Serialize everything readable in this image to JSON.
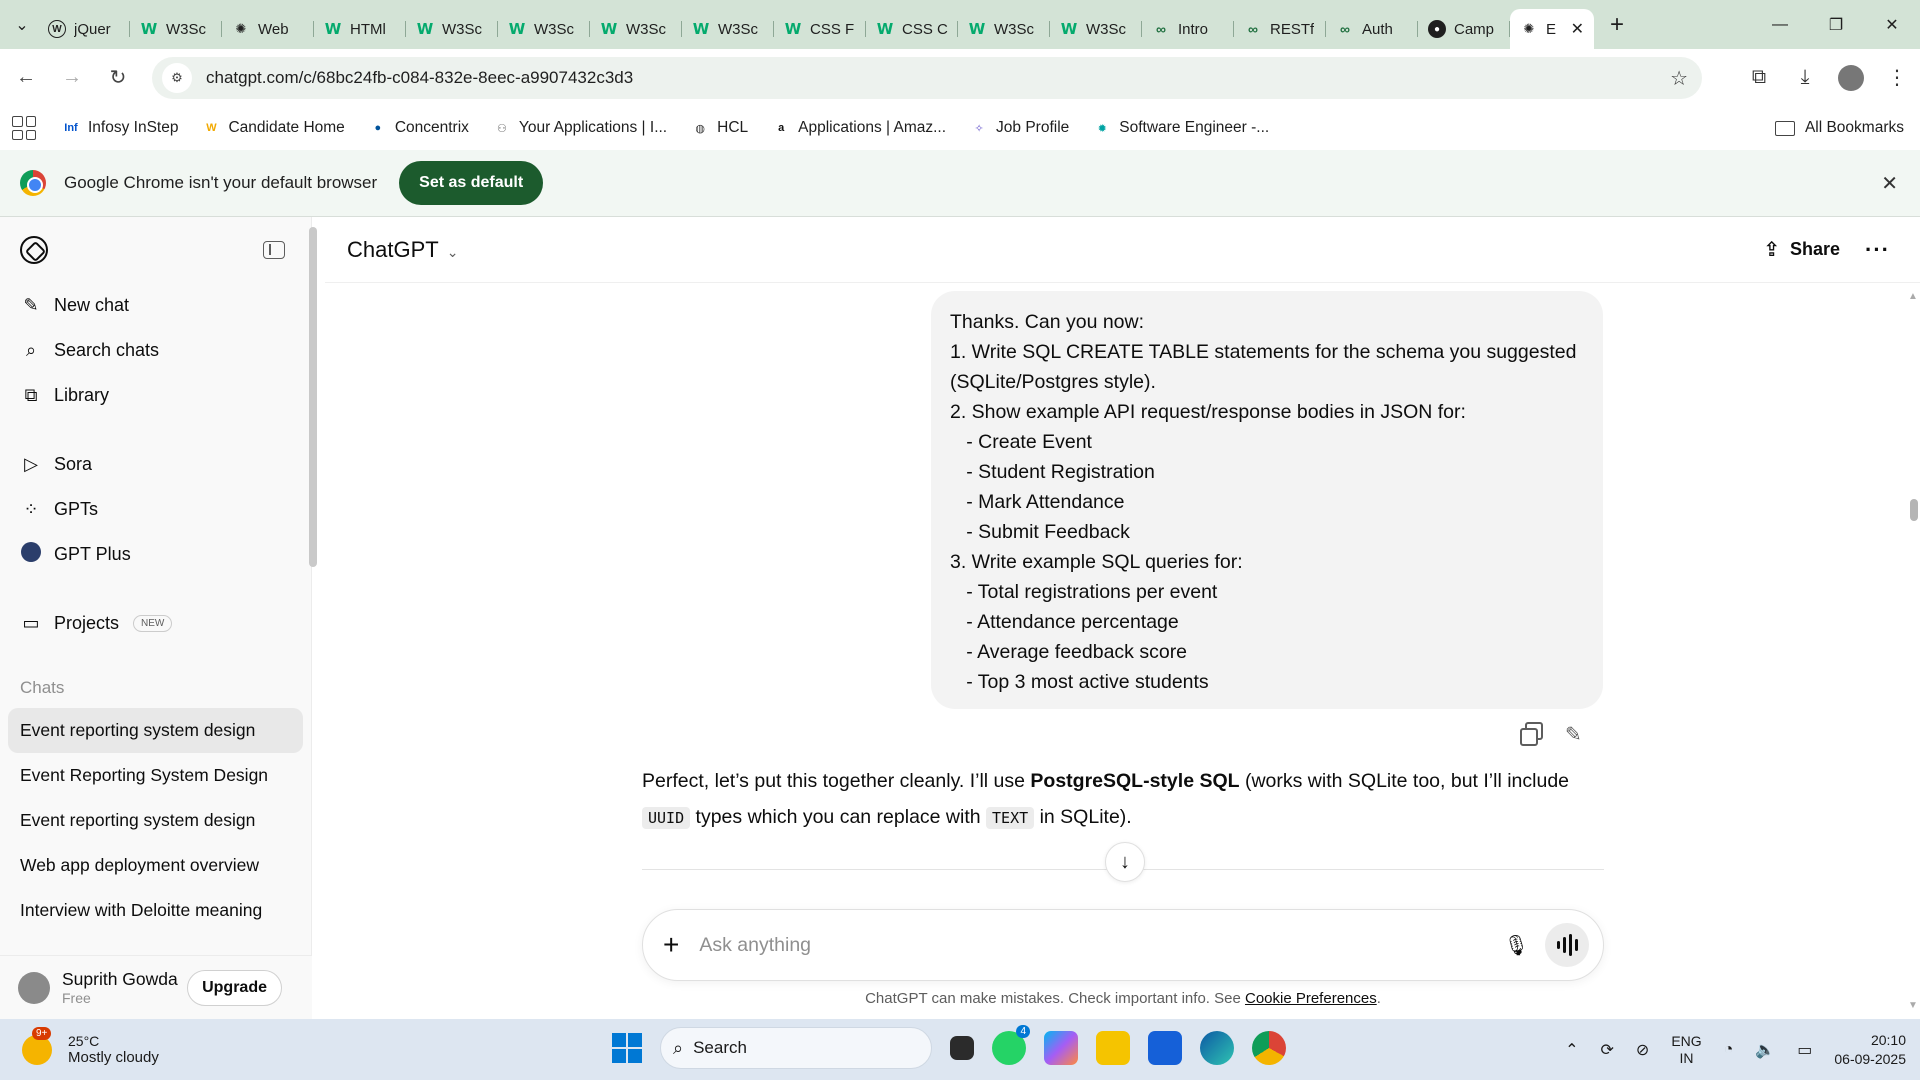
{
  "browser": {
    "tabs": [
      {
        "label": "jQuer",
        "icon": "jquery-icon"
      },
      {
        "label": "W3Sc",
        "icon": "w3schools-icon"
      },
      {
        "label": "Web",
        "icon": "chatgpt-icon"
      },
      {
        "label": "HTMl",
        "icon": "w3schools-icon"
      },
      {
        "label": "W3Sc",
        "icon": "w3schools-icon"
      },
      {
        "label": "W3Sc",
        "icon": "w3schools-icon"
      },
      {
        "label": "W3Sc",
        "icon": "w3schools-icon"
      },
      {
        "label": "W3Sc",
        "icon": "w3schools-icon"
      },
      {
        "label": "CSS F",
        "icon": "w3schools-icon"
      },
      {
        "label": "CSS C",
        "icon": "w3schools-icon"
      },
      {
        "label": "W3Sc",
        "icon": "w3schools-icon"
      },
      {
        "label": "W3Sc",
        "icon": "w3schools-icon"
      },
      {
        "label": "Intro",
        "icon": "geeksforgeeks-icon"
      },
      {
        "label": "RESTf",
        "icon": "geeksforgeeks-icon"
      },
      {
        "label": "Auth",
        "icon": "geeksforgeeks-icon"
      },
      {
        "label": "Camp",
        "icon": "github-icon"
      }
    ],
    "active_tab": {
      "label": "E",
      "icon": "chatgpt-icon"
    },
    "url": "chatgpt.com/c/68bc24fb-c084-832e-8eec-a9907432c3d3",
    "bookmarks": [
      {
        "label": "Infosy InStep",
        "icon": "infosys-icon",
        "color": "#0052cc"
      },
      {
        "label": "Candidate Home",
        "icon": "candidate-home-icon",
        "color": "#f2a900"
      },
      {
        "label": "Concentrix",
        "icon": "concentrix-icon",
        "color": "#00539b"
      },
      {
        "label": "Your Applications | I...",
        "icon": "applications-icon",
        "color": "#6b6b6b"
      },
      {
        "label": "HCL",
        "icon": "globe-icon",
        "color": "#333333"
      },
      {
        "label": "Applications | Amaz...",
        "icon": "amazon-icon",
        "color": "#111111"
      },
      {
        "label": "Job Profile",
        "icon": "job-profile-icon",
        "color": "#6a5acd"
      },
      {
        "label": "Software Engineer -...",
        "icon": "gear-icon",
        "color": "#00a3a3"
      }
    ],
    "all_bookmarks": "All Bookmarks",
    "infobar": {
      "message": "Google Chrome isn't your default browser",
      "button": "Set as default"
    }
  },
  "sidebar": {
    "primary": [
      {
        "label": "New chat",
        "icon": "new-chat-icon"
      },
      {
        "label": "Search chats",
        "icon": "search-icon"
      },
      {
        "label": "Library",
        "icon": "library-icon"
      }
    ],
    "secondary": [
      {
        "label": "Sora",
        "icon": "play-icon"
      },
      {
        "label": "GPTs",
        "icon": "grid-icon"
      },
      {
        "label": "GPT Plus",
        "icon": "gpt-plus-icon"
      }
    ],
    "projects": {
      "label": "Projects",
      "badge": "NEW"
    },
    "chats_heading": "Chats",
    "chats": [
      "Event reporting system design",
      "Event Reporting System Design",
      "Event reporting system design",
      "Web app deployment overview",
      "Interview with Deloitte meaning"
    ],
    "user": {
      "name": "Suprith Gowda",
      "plan": "Free",
      "upgrade": "Upgrade"
    }
  },
  "main": {
    "model": "ChatGPT",
    "share": "Share",
    "user_message": [
      "Thanks. Can you now:",
      "1. Write SQL CREATE TABLE statements for the schema you suggested",
      "(SQLite/Postgres style).",
      "2. Show example API request/response bodies in JSON for:",
      "   - Create Event",
      "   - Student Registration",
      "   - Mark Attendance",
      "   - Submit Feedback",
      "3. Write example SQL queries for:",
      "   - Total registrations per event",
      "   - Attendance percentage",
      "   - Average feedback score",
      "   - Top 3 most active students"
    ],
    "assistant": {
      "p1": "Perfect, let’s put this together cleanly. I’ll use ",
      "bold": "PostgreSQL-style SQL",
      "p2": " (works with SQLite too, but I’ll include",
      "code1": "UUID",
      "p3": " types which you can replace with ",
      "code2": "TEXT",
      "p4": " in SQLite)."
    },
    "composer_placeholder": "Ask anything",
    "disclaimer": "ChatGPT can make mistakes. Check important info. See ",
    "disclaimer_link": "Cookie Preferences",
    "disclaimer_end": "."
  },
  "taskbar": {
    "weather": {
      "temp": "25°C",
      "desc": "Mostly cloudy",
      "badge": "9+"
    },
    "search": "Search",
    "whatsapp_count": "4",
    "lang": [
      "ENG",
      "IN"
    ],
    "time": "20:10",
    "date": "06-09-2025"
  }
}
